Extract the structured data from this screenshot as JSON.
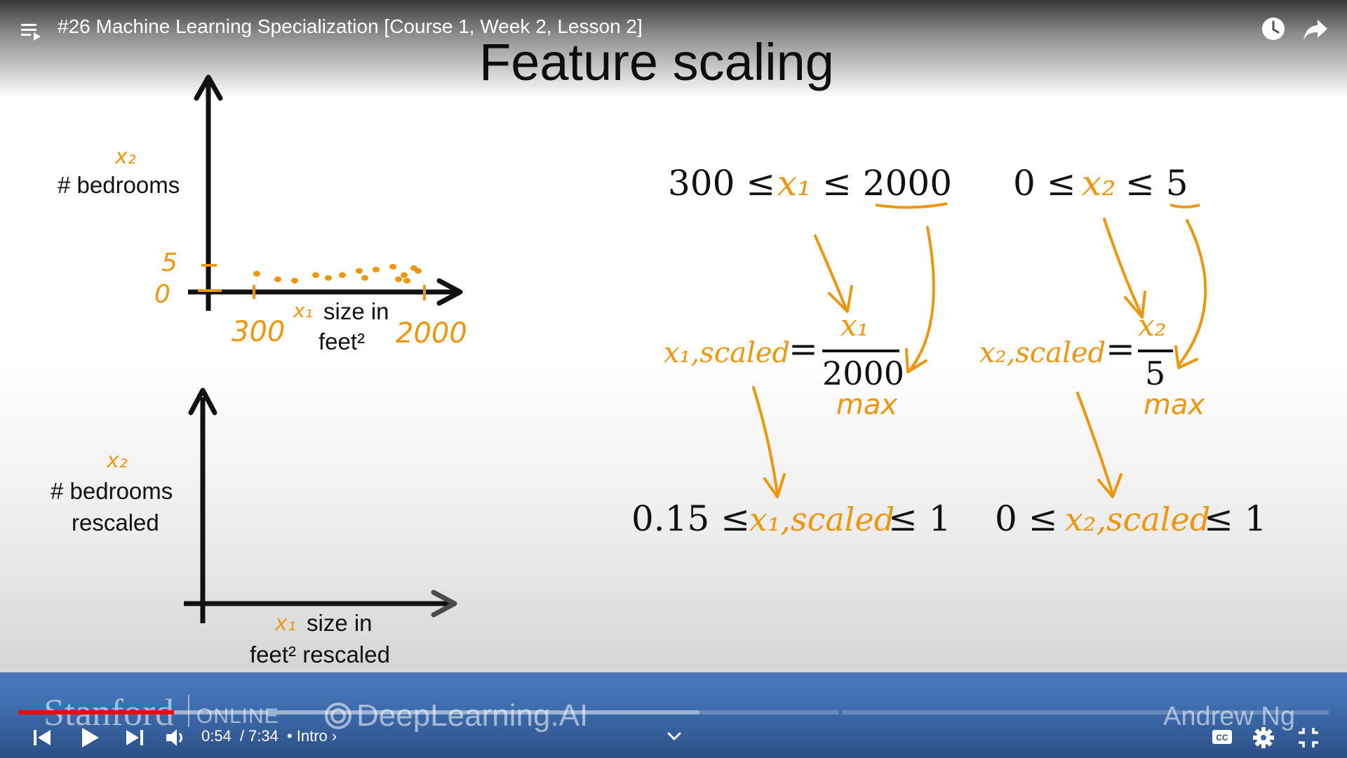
{
  "window": {
    "title": "#26 Machine Learning Specialization [Course 1, Week 2, Lesson 2]"
  },
  "slide": {
    "title": "Feature scaling",
    "plot_top": {
      "y_var": "x₂",
      "y_label": "# bedrooms",
      "y_tick_5": "5",
      "y_tick_0": "0",
      "x_var": "x₁",
      "x_label_line1": "size in",
      "x_label_line2": "feet²",
      "x_tick_min": "300",
      "x_tick_max": "2000"
    },
    "plot_bottom": {
      "y_var": "x₂",
      "y_label_line1": "# bedrooms",
      "y_label_line2": "rescaled",
      "x_var": "x₁",
      "x_label_line1": "size in",
      "x_label_line2": "feet² rescaled"
    },
    "equations": {
      "range1_left": "300 ≤",
      "range1_var": "x₁",
      "range1_right": "≤ 2000",
      "range2_left": "0 ≤",
      "range2_var": "x₂",
      "range2_right": "≤ 5",
      "scaled1_lhs": "x₁,scaled",
      "scaled1_eq": "=",
      "scaled1_num": "x₁",
      "scaled1_den": "2000",
      "scaled1_note": "max",
      "scaled2_lhs": "x₂,scaled",
      "scaled2_eq": "=",
      "scaled2_num": "x₂",
      "scaled2_den": "5",
      "scaled2_note": "max",
      "result1_left": "0.15 ≤",
      "result1_var": "x₁,scaled",
      "result1_right": "≤ 1",
      "result2_left": "0 ≤",
      "result2_var": "x₂,scaled",
      "result2_right": "≤ 1"
    }
  },
  "banner": {
    "stanford": "Stanford",
    "online": "ONLINE",
    "deeplearning": "DeepLearning.AI",
    "presenter": "Andrew Ng"
  },
  "player": {
    "current_time": "0:54",
    "duration": "7:34",
    "time_separator": "/",
    "chapter_bullet": "•",
    "chapter": "Intro",
    "chapter_arrow": "›",
    "progress_fraction": 0.119,
    "buffered_fraction": 0.52
  },
  "colors": {
    "accent_orange": "#f0960e",
    "progress_red": "#ff0000",
    "banner_blue": "#3f6daf"
  },
  "icons": [
    "playlist-icon",
    "clock-icon",
    "share-icon",
    "previous-icon",
    "play-icon",
    "next-icon",
    "volume-icon",
    "chevron-down-icon",
    "cc-icon",
    "settings-icon",
    "exit-fullscreen-icon"
  ]
}
